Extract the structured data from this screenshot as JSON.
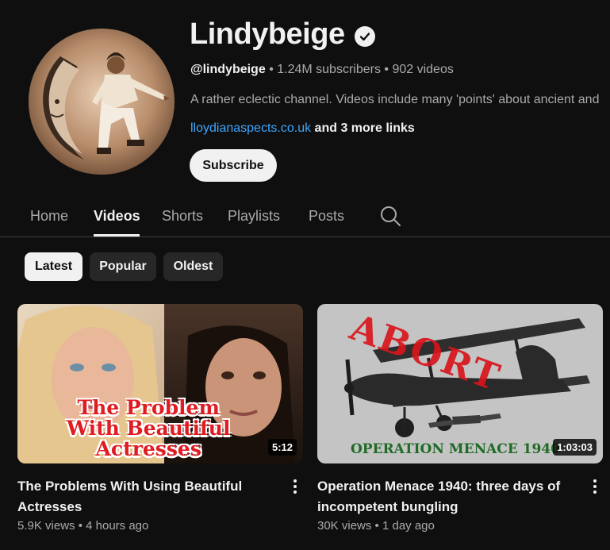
{
  "channel": {
    "name": "Lindybeige",
    "handle": "@lindybeige",
    "subscribers": "1.24M subscribers",
    "videos_count": "902 videos",
    "description": "A rather eclectic channel.  Videos include many 'points' about ancient and",
    "link": "lloydianaspects.co.uk",
    "more_links": "and 3 more links",
    "subscribe_label": "Subscribe",
    "verified_icon": "check-circle-icon"
  },
  "tabs": [
    {
      "label": "Home"
    },
    {
      "label": "Videos",
      "active": true
    },
    {
      "label": "Shorts"
    },
    {
      "label": "Playlists"
    },
    {
      "label": "Posts"
    }
  ],
  "filters": [
    {
      "label": "Latest",
      "active": true
    },
    {
      "label": "Popular"
    },
    {
      "label": "Oldest"
    }
  ],
  "videos": [
    {
      "title": "The Problems With Using Beautiful Actresses",
      "views": "5.9K views",
      "age": "4 hours ago",
      "duration": "5:12",
      "thumb_text": [
        "The Problem",
        "With Beautiful",
        "Actresses"
      ]
    },
    {
      "title": "Operation Menace 1940: three days of incompetent bungling",
      "views": "30K views",
      "age": "1 day ago",
      "duration": "1:03:03",
      "thumb_stamp": "ABORT",
      "thumb_caption": "OPERATION MENACE 1940"
    }
  ],
  "colors": {
    "background": "#0f0f0f",
    "link": "#3ea6ff",
    "chip": "#272727",
    "thumb_red": "#d7161c",
    "thumb_green": "#1f6b25"
  }
}
